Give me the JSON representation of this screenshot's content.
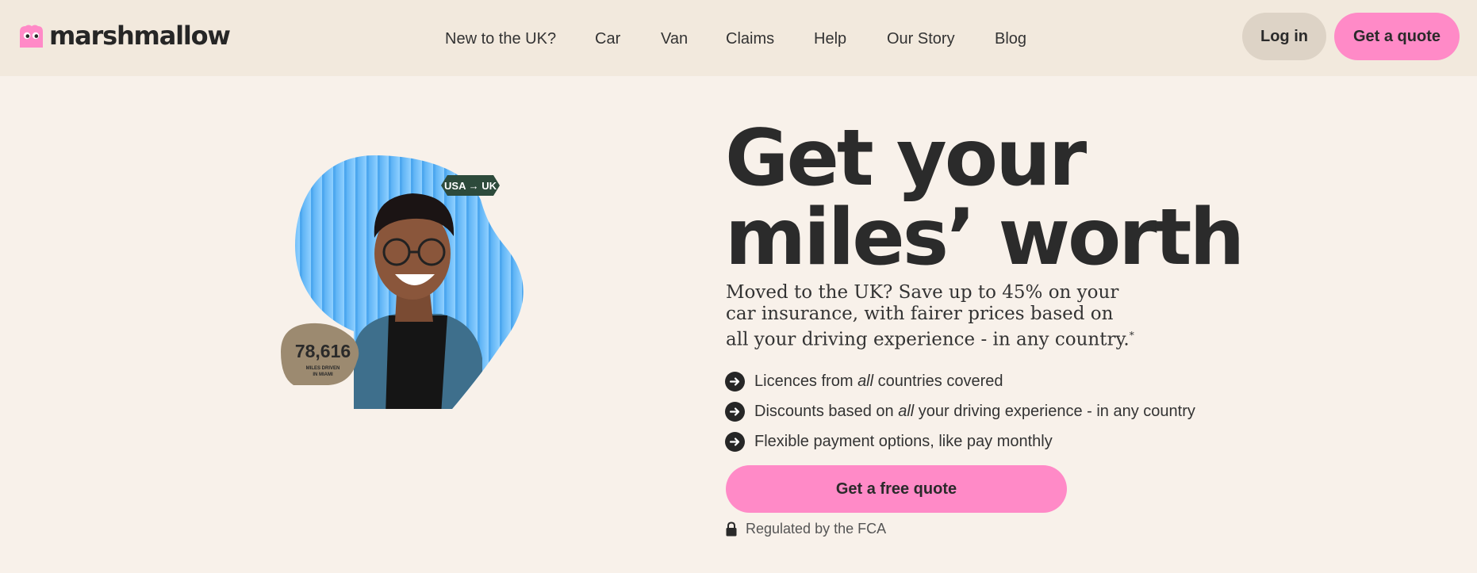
{
  "brand": {
    "name": "marshmallow",
    "accent_pink": "#ff8ac7",
    "background": "#f8f1ea",
    "header_bg": "#f2e9dd"
  },
  "nav": {
    "items": [
      {
        "label": "New to the UK?"
      },
      {
        "label": "Car"
      },
      {
        "label": "Van"
      },
      {
        "label": "Claims"
      },
      {
        "label": "Help"
      },
      {
        "label": "Our Story"
      },
      {
        "label": "Blog"
      }
    ],
    "login_label": "Log in",
    "quote_label": "Get a quote"
  },
  "hero": {
    "route_badge": "USA → UK",
    "miles_count": "78,616",
    "miles_caption_line1": "MILES DRIVEN",
    "miles_caption_line2": "IN MIAMI",
    "title_line1": "Get your",
    "title_line2": "miles’ worth",
    "subtitle": "Moved to the UK? Save up to 45% on your car insurance, with fairer prices based on all your driving experience - in any country.",
    "subtitle_mark": "*",
    "benefits": [
      {
        "before": "Licences from ",
        "emphasis": "all",
        "after": " countries covered",
        "icon": "arrow-right-circle-icon"
      },
      {
        "before": "Discounts based on ",
        "emphasis": "all",
        "after": " your driving experience - in any country",
        "icon": "arrow-right-circle-icon"
      },
      {
        "before": "Flexible payment options, like pay monthly",
        "emphasis": "",
        "after": "",
        "icon": "arrow-right-circle-icon"
      }
    ],
    "cta_label": "Get a free quote",
    "regulation_text": "Regulated by the FCA",
    "regulation_icon": "lock-icon"
  }
}
